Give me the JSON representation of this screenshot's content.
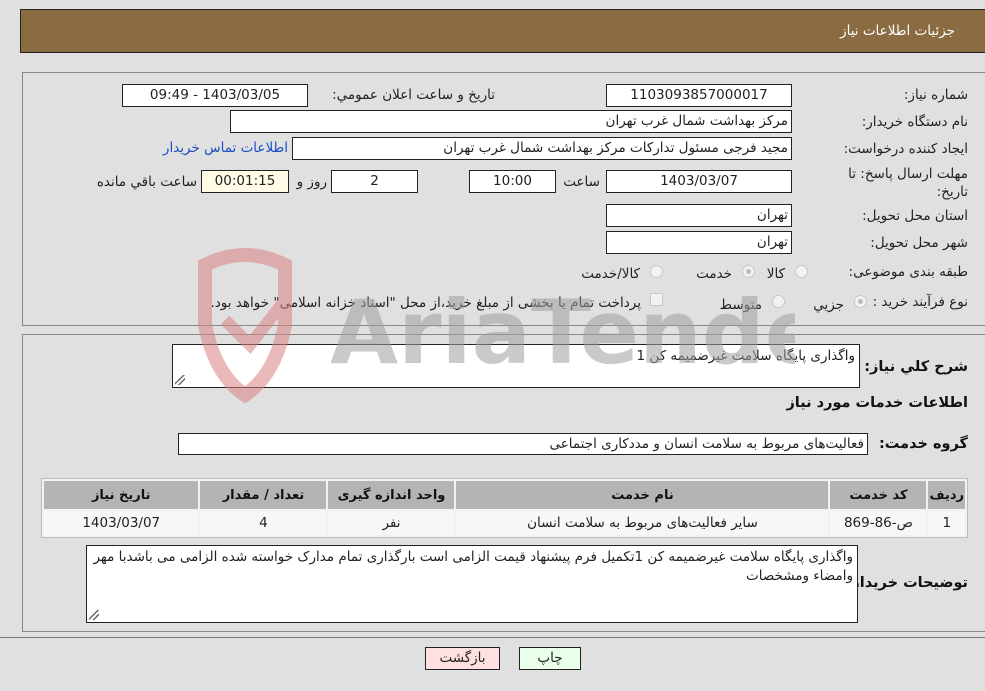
{
  "header": {
    "title": "جزئيات اطلاعات نياز"
  },
  "need_details": {
    "need_number_label": "شماره نياز:",
    "need_number": "1103093857000017",
    "announce_label": "تاريخ و ساعت اعلان عمومي:",
    "announce_value": "1403/03/05 - 09:49",
    "buyer_org_label": "نام دستگاه خريدار:",
    "buyer_org": "مرکز بهداشت شمال غرب تهران",
    "creator_label": "ايجاد کننده درخواست:",
    "creator": "مجید فرجی مسئول تدارکات مرکز بهداشت شمال غرب تهران",
    "buyer_contact_link": "اطلاعات تماس خريدار",
    "deadline_label": "مهلت ارسال پاسخ: تا تاريخ:",
    "deadline_date": "1403/03/07",
    "time_label": "ساعت",
    "deadline_time": "10:00",
    "days_value": "2",
    "days_label": "روز و",
    "remaining_time": "00:01:15",
    "remaining_label": "ساعت باقي مانده",
    "province_label": "استان محل تحويل:",
    "province": "تهران",
    "city_label": "شهر محل تحويل:",
    "city": "تهران",
    "category_label": "طبقه بندی موضوعی:",
    "category_options": [
      "کالا",
      "خدمت",
      "کالا/خدمت"
    ],
    "category_selected": "خدمت",
    "process_label": "نوع فرآيند خريد :",
    "process_options": [
      "جزيي",
      "متوسط"
    ],
    "treasury_note": "پرداخت تمام يا بخشی از مبلغ خريد،از محل \"اسناد خزانه اسلامی\" خواهد بود."
  },
  "summary": {
    "desc_label": "شرح کلي نياز:",
    "desc_value": "واگذاری پایگاه سلامت غیرضمیمه کن 1",
    "services_heading": "اطلاعات خدمات مورد نياز",
    "group_label": "گروه خدمت:",
    "group_value": "فعاليت‌های مربوط به سلامت انسان و مددکاری اجتماعی"
  },
  "table": {
    "headers": [
      "رديف",
      "کد خدمت",
      "نام خدمت",
      "واحد اندازه گيری",
      "تعداد / مقدار",
      "تاريخ نياز"
    ],
    "rows": [
      [
        "1",
        "ص-86-869",
        "ساير فعاليت‌های مربوط به سلامت انسان",
        "نفر",
        "4",
        "1403/03/07"
      ]
    ]
  },
  "buyer_notes": {
    "label": "توضيحات خريدار:",
    "value": "واگذاری پایگاه سلامت غیرضمیمه کن 1تکمیل فرم پیشنهاد قیمت الزامی است بارگذاری تمام مدارک خواسته شده الزامی می باشدبا مهر وامضاء ومشخصات"
  },
  "buttons": {
    "print": "چاپ",
    "back": "بازگشت"
  },
  "watermark": {
    "text": "AriaTender.neT"
  },
  "colors": {
    "header_bg": "#8b6c42",
    "back_btn_bg": "#ffe0e0",
    "print_btn_bg": "#eaffea",
    "link": "#1a4fc7"
  }
}
